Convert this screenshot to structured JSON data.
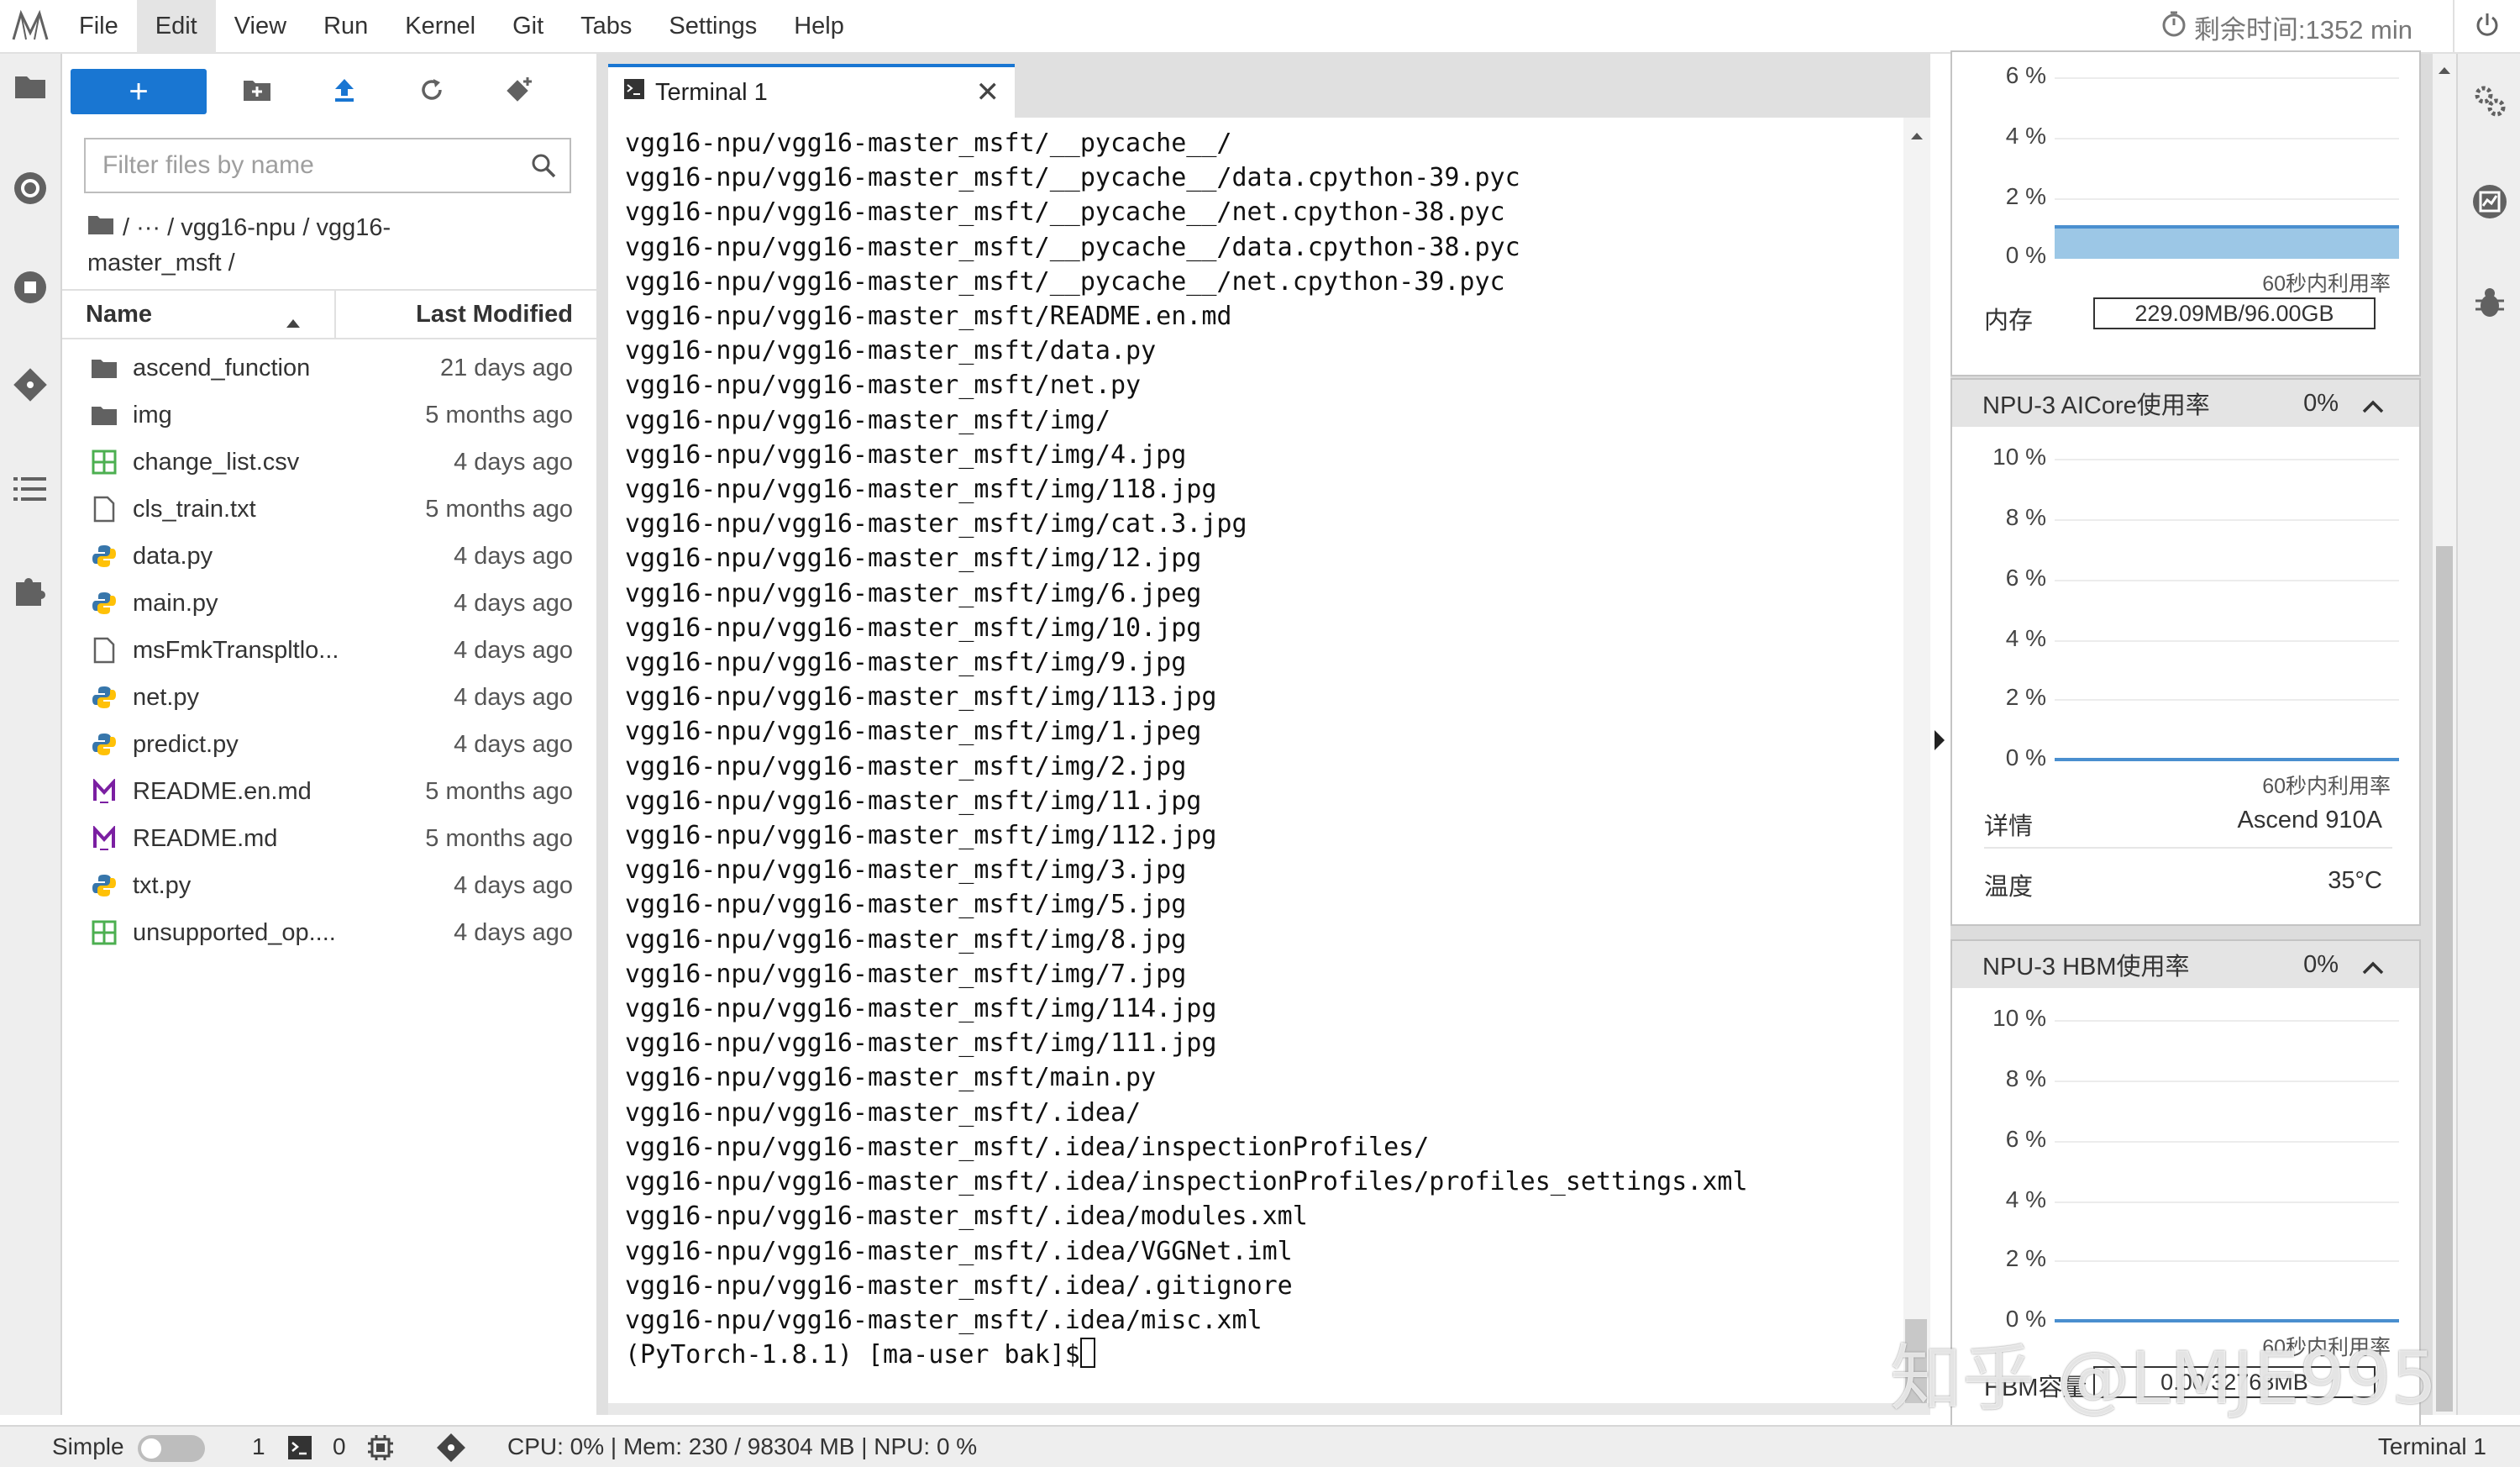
{
  "menubar": {
    "items": [
      "File",
      "Edit",
      "View",
      "Run",
      "Kernel",
      "Git",
      "Tabs",
      "Settings",
      "Help"
    ],
    "active": "Edit",
    "timer": "剩余时间:1352 min"
  },
  "filebrowser": {
    "new_label": "+",
    "filter_placeholder": "Filter files by name",
    "breadcrumb_line1": "/   ···   / vgg16-npu / vgg16-",
    "breadcrumb_line2": "master_msft /",
    "col_name": "Name",
    "col_modified": "Last Modified",
    "files": [
      {
        "name": "ascend_function",
        "modified": "21 days ago",
        "icon": "folder-icon"
      },
      {
        "name": "img",
        "modified": "5 months ago",
        "icon": "folder-icon"
      },
      {
        "name": "change_list.csv",
        "modified": "4 days ago",
        "icon": "spreadsheet-icon"
      },
      {
        "name": "cls_train.txt",
        "modified": "5 months ago",
        "icon": "text-file-icon"
      },
      {
        "name": "data.py",
        "modified": "4 days ago",
        "icon": "python-icon"
      },
      {
        "name": "main.py",
        "modified": "4 days ago",
        "icon": "python-icon"
      },
      {
        "name": "msFmkTranspltlo...",
        "modified": "4 days ago",
        "icon": "text-file-icon"
      },
      {
        "name": "net.py",
        "modified": "4 days ago",
        "icon": "python-icon"
      },
      {
        "name": "predict.py",
        "modified": "4 days ago",
        "icon": "python-icon"
      },
      {
        "name": "README.en.md",
        "modified": "5 months ago",
        "icon": "markdown-icon"
      },
      {
        "name": "README.md",
        "modified": "5 months ago",
        "icon": "markdown-icon"
      },
      {
        "name": "txt.py",
        "modified": "4 days ago",
        "icon": "python-icon"
      },
      {
        "name": "unsupported_op....",
        "modified": "4 days ago",
        "icon": "spreadsheet-icon"
      }
    ]
  },
  "terminal": {
    "tab_label": "Terminal 1",
    "lines": [
      "vgg16-npu/vgg16-master_msft/__pycache__/",
      "vgg16-npu/vgg16-master_msft/__pycache__/data.cpython-39.pyc",
      "vgg16-npu/vgg16-master_msft/__pycache__/net.cpython-38.pyc",
      "vgg16-npu/vgg16-master_msft/__pycache__/data.cpython-38.pyc",
      "vgg16-npu/vgg16-master_msft/__pycache__/net.cpython-39.pyc",
      "vgg16-npu/vgg16-master_msft/README.en.md",
      "vgg16-npu/vgg16-master_msft/data.py",
      "vgg16-npu/vgg16-master_msft/net.py",
      "vgg16-npu/vgg16-master_msft/img/",
      "vgg16-npu/vgg16-master_msft/img/4.jpg",
      "vgg16-npu/vgg16-master_msft/img/118.jpg",
      "vgg16-npu/vgg16-master_msft/img/cat.3.jpg",
      "vgg16-npu/vgg16-master_msft/img/12.jpg",
      "vgg16-npu/vgg16-master_msft/img/6.jpeg",
      "vgg16-npu/vgg16-master_msft/img/10.jpg",
      "vgg16-npu/vgg16-master_msft/img/9.jpg",
      "vgg16-npu/vgg16-master_msft/img/113.jpg",
      "vgg16-npu/vgg16-master_msft/img/1.jpeg",
      "vgg16-npu/vgg16-master_msft/img/2.jpg",
      "vgg16-npu/vgg16-master_msft/img/11.jpg",
      "vgg16-npu/vgg16-master_msft/img/112.jpg",
      "vgg16-npu/vgg16-master_msft/img/3.jpg",
      "vgg16-npu/vgg16-master_msft/img/5.jpg",
      "vgg16-npu/vgg16-master_msft/img/8.jpg",
      "vgg16-npu/vgg16-master_msft/img/7.jpg",
      "vgg16-npu/vgg16-master_msft/img/114.jpg",
      "vgg16-npu/vgg16-master_msft/img/111.jpg",
      "vgg16-npu/vgg16-master_msft/main.py",
      "vgg16-npu/vgg16-master_msft/.idea/",
      "vgg16-npu/vgg16-master_msft/.idea/inspectionProfiles/",
      "vgg16-npu/vgg16-master_msft/.idea/inspectionProfiles/profiles_settings.xml",
      "vgg16-npu/vgg16-master_msft/.idea/modules.xml",
      "vgg16-npu/vgg16-master_msft/.idea/VGGNet.iml",
      "vgg16-npu/vgg16-master_msft/.idea/.gitignore",
      "vgg16-npu/vgg16-master_msft/.idea/misc.xml"
    ],
    "prompt": "(PyTorch-1.8.1) [ma-user bak]$"
  },
  "monitor": {
    "cpu_card": {
      "ylabels": [
        "6 %",
        "4 %",
        "2 %",
        "0 %"
      ],
      "caption": "60秒内利用率",
      "mem_label": "内存",
      "mem_value": "229.09MB/96.00GB"
    },
    "aicore_card": {
      "title": "NPU-3 AICore使用率",
      "pct": "0%",
      "ylabels": [
        "10 %",
        "8 %",
        "6 %",
        "4 %",
        "2 %",
        "0 %"
      ],
      "caption": "60秒内利用率",
      "detail_label": "详情",
      "detail_value": "Ascend 910A",
      "temp_label": "温度",
      "temp_value": "35°C"
    },
    "hbm_card": {
      "title": "NPU-3 HBM使用率",
      "pct": "0%",
      "ylabels": [
        "10 %",
        "8 %",
        "6 %",
        "4 %",
        "2 %",
        "0 %"
      ],
      "caption": "60秒内利用率",
      "cap_label": "HBM容量",
      "cap_value": "0.00/32768MB"
    }
  },
  "statusbar": {
    "simple_label": "Simple",
    "terminals_count": "1",
    "kernels_count": "0",
    "resources": "CPU: 0% | Mem: 230 / 98304 MB | NPU: 0 %",
    "active_tab": "Terminal 1"
  },
  "watermark": "知乎 @LMJE995",
  "colors": {
    "accent": "#1976d2",
    "chart_line": "#4a8fcf",
    "chart_fill": "#9cc7e6"
  }
}
